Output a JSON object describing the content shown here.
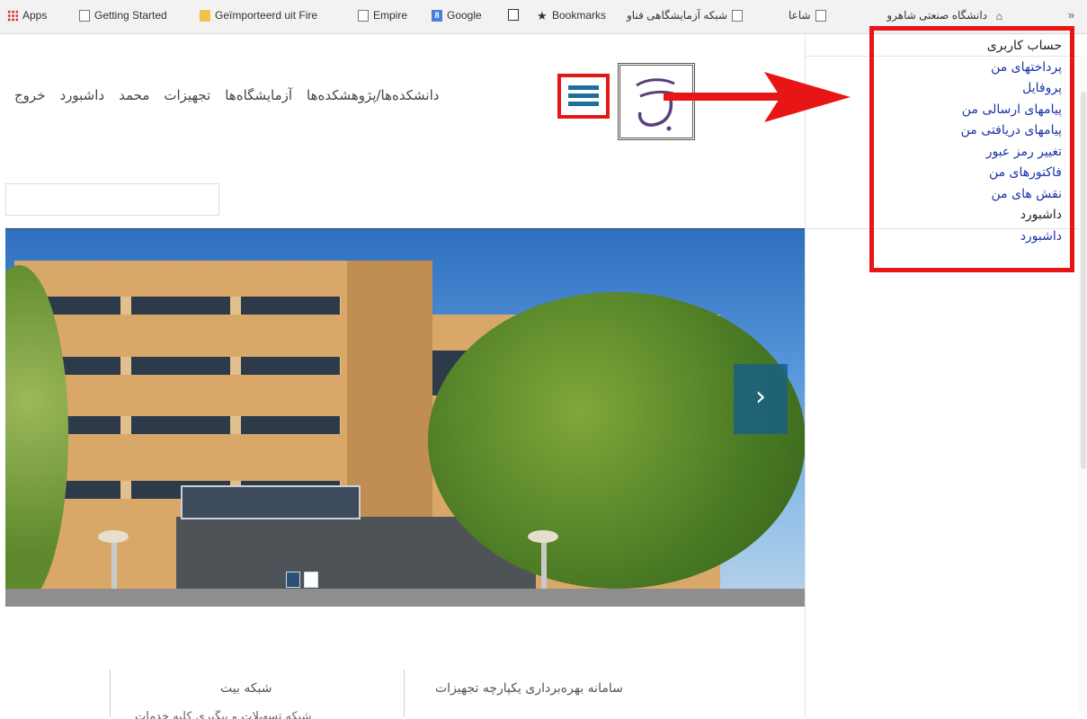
{
  "bookmarks_bar": {
    "items": [
      {
        "label": "Apps",
        "icon": "apps-grid-icon"
      },
      {
        "label": "Getting Started",
        "icon": "page-icon"
      },
      {
        "label": "Geïmporteerd uit Fire",
        "icon": "folder-icon"
      },
      {
        "label": "Empire",
        "icon": "page-icon"
      },
      {
        "label": "Google",
        "icon": "google-icon"
      },
      {
        "label": "",
        "icon": "chart-icon"
      },
      {
        "label": "Bookmarks",
        "icon": "star-icon"
      },
      {
        "label": "شبکه آزمایشگاهی فناو",
        "icon": "page-icon"
      },
      {
        "label": "شاعا",
        "icon": "page-icon"
      },
      {
        "label": "دانشگاه صنعتی شاهرو",
        "icon": "building-icon"
      }
    ],
    "overflow": "»"
  },
  "nav": {
    "items": [
      "دانشکده‌ها/پژوهشکده‌ها",
      "آزمایشگاه‌ها",
      "تجهیزات",
      "محمد",
      "داشبورد",
      "خروج"
    ]
  },
  "search": {
    "placeholder": ""
  },
  "hero": {
    "next_label": "›",
    "slide_count": 2,
    "active_slide": 2
  },
  "footer": {
    "col_right_title": "سامانه بهره‌برداری یکپارچه تجهیزات",
    "col_mid_title": "شبکه بیت",
    "col_mid_cut": "شبکه تسهیلات و پیگیری کلیه خدمات"
  },
  "user_menu": {
    "header": "حساب کاربری",
    "links": [
      "پرداختهای من",
      "پروفایل",
      "پیامهای ارسالی من",
      "پیامهای دریافتی من",
      "تغییر رمز عبور",
      "فاکتورهای من",
      "نقش های من"
    ],
    "section2_header": "داشبورد",
    "section2_link": "داشبورد"
  },
  "annotation": {
    "color": "#e81515"
  },
  "colors": {
    "menu_accent": "#1d6f9f",
    "link": "#1a33a8"
  }
}
